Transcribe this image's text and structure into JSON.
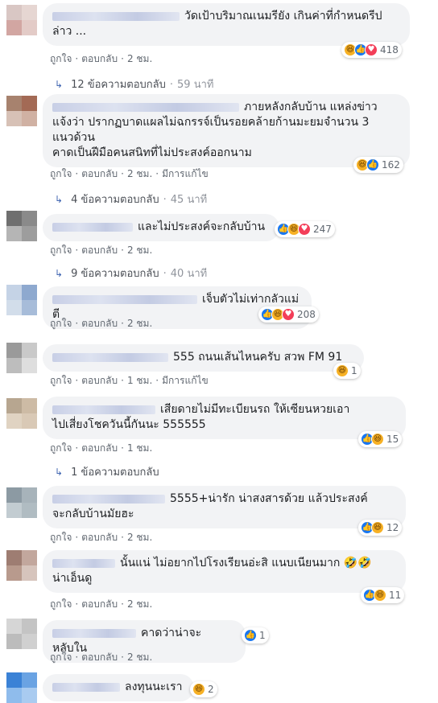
{
  "colors": {
    "bubble": "#f2f3f5",
    "like": "#1877f2",
    "love": "#f33e58",
    "haha": "#f7b125",
    "action_text": "#606770",
    "reply_arrow": "#4267b2"
  },
  "labels": {
    "like": "ถูกใจ",
    "reply": "ตอบกลับ",
    "edited": "มีการแก้ไข",
    "dot": "·"
  },
  "comments": [
    {
      "text": "วัดเป้าบริมาณเนมรียัง เกินค่าที่กำหนดรีป\nล่าว ...",
      "time": "2 ชม.",
      "reactions": {
        "icons": [
          "haha-icon",
          "like-icon",
          "love-icon"
        ],
        "count": "418"
      },
      "replies": {
        "label": "12 ข้อความตอบกลับ",
        "time": "59 นาที"
      }
    },
    {
      "text": "ภายหลังกลับบ้าน แหล่งข่าว\nแจ้งว่า ปรากฏบาดแผลไม่ฉกรรจ์เป็นรอยคล้ายก้านมะยมจำนวน 3\nแนวด้วน\nคาดเป็นฝีมือคนสนิทที่ไม่ประสงค์ออกนาม",
      "time": "2 ชม.",
      "edited": true,
      "reactions": {
        "icons": [
          "haha-icon",
          "like-icon"
        ],
        "count": "162"
      },
      "replies": {
        "label": "4 ข้อความตอบกลับ",
        "time": "45 นาที"
      }
    },
    {
      "text": "และไม่ประสงค์จะกลับบ้าน",
      "time": "2 ชม.",
      "reactions": {
        "icons": [
          "like-icon",
          "haha-icon",
          "love-icon"
        ],
        "count": "247"
      },
      "replies": {
        "label": "9 ข้อความตอบกลับ",
        "time": "40 นาที"
      }
    },
    {
      "text": "เจ็บตัวไม่เท่ากลัวแม่ตี",
      "time": "2 ชม.",
      "reactions": {
        "icons": [
          "like-icon",
          "haha-icon",
          "love-icon"
        ],
        "count": "208"
      }
    },
    {
      "text": "555 ถนนเส้นไหนครับ สวพ FM 91",
      "time": "1 ชม.",
      "edited": true,
      "reactions": {
        "icons": [
          "haha-icon"
        ],
        "count": "1"
      }
    },
    {
      "text": "เสียดายไม่มีทะเบียนรถ ให้เซียนหวยเอา\nไปเสี่ยงโชควันนี้กันนะ 555555",
      "time": "1 ชม.",
      "reactions": {
        "icons": [
          "like-icon",
          "haha-icon"
        ],
        "count": "15"
      },
      "replies": {
        "label": "1 ข้อความตอบกลับ"
      }
    },
    {
      "text": "5555+น่ารัก น่าสงสารด้วย แล้วประสงค์\nจะกลับบ้านมัยฮะ",
      "time": "2 ชม.",
      "reactions": {
        "icons": [
          "like-icon",
          "haha-icon"
        ],
        "count": "12"
      }
    },
    {
      "text": "นั้นแน่ ไม่อยากไปโรงเรียนอ่ะสิ แนบเนียนมาก 🤣🤣\nน่าเอ็นดู",
      "time": "2 ชม.",
      "reactions": {
        "icons": [
          "like-icon",
          "haha-icon"
        ],
        "count": "11"
      }
    },
    {
      "text": "คาดว่าน่าจะหลับใน",
      "time": "2 ชม.",
      "reactions": {
        "icons": [
          "like-icon"
        ],
        "count": "1"
      }
    },
    {
      "text": "ลงทุนนะเรา",
      "reactions": {
        "icons": [
          "haha-icon"
        ],
        "count": "2"
      }
    }
  ]
}
